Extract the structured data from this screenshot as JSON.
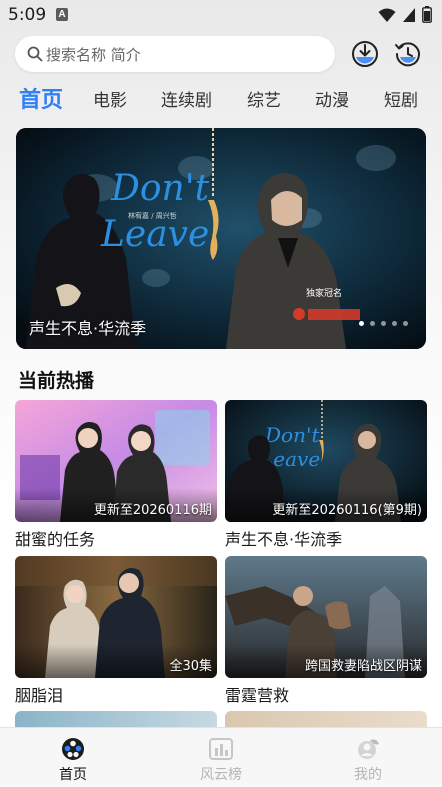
{
  "status_bar": {
    "time": "5:09",
    "notification_badge": "A"
  },
  "search": {
    "placeholder": "搜索名称 简介"
  },
  "tabs": [
    {
      "label": "首页",
      "active": true
    },
    {
      "label": "电影"
    },
    {
      "label": "连续剧"
    },
    {
      "label": "综艺"
    },
    {
      "label": "动漫"
    },
    {
      "label": "短剧"
    }
  ],
  "banner": {
    "title": "声生不息·华流季",
    "art_text": "Don't Leave",
    "art_sub": "林宥嘉 / 周兴哲",
    "art_tag": "独家冠名",
    "page_count": 5,
    "active_page": 0
  },
  "section": {
    "title": "当前热播"
  },
  "cards": [
    {
      "title": "甜蜜的任务",
      "badge": "更新至20260116期"
    },
    {
      "title": "声生不息·华流季",
      "badge": "更新至20260116(第9期)"
    },
    {
      "title": "胭脂泪",
      "badge": "全30集"
    },
    {
      "title": "雷霆营救",
      "badge": "跨国救妻陷战区阴谋"
    }
  ],
  "bottom_nav": [
    {
      "label": "首页",
      "icon": "home-film-icon",
      "active": true
    },
    {
      "label": "风云榜",
      "icon": "chart-icon"
    },
    {
      "label": "我的",
      "icon": "profile-icon"
    }
  ],
  "colors": {
    "accent": "#2f7ff5",
    "background": "#f6f6f7"
  }
}
